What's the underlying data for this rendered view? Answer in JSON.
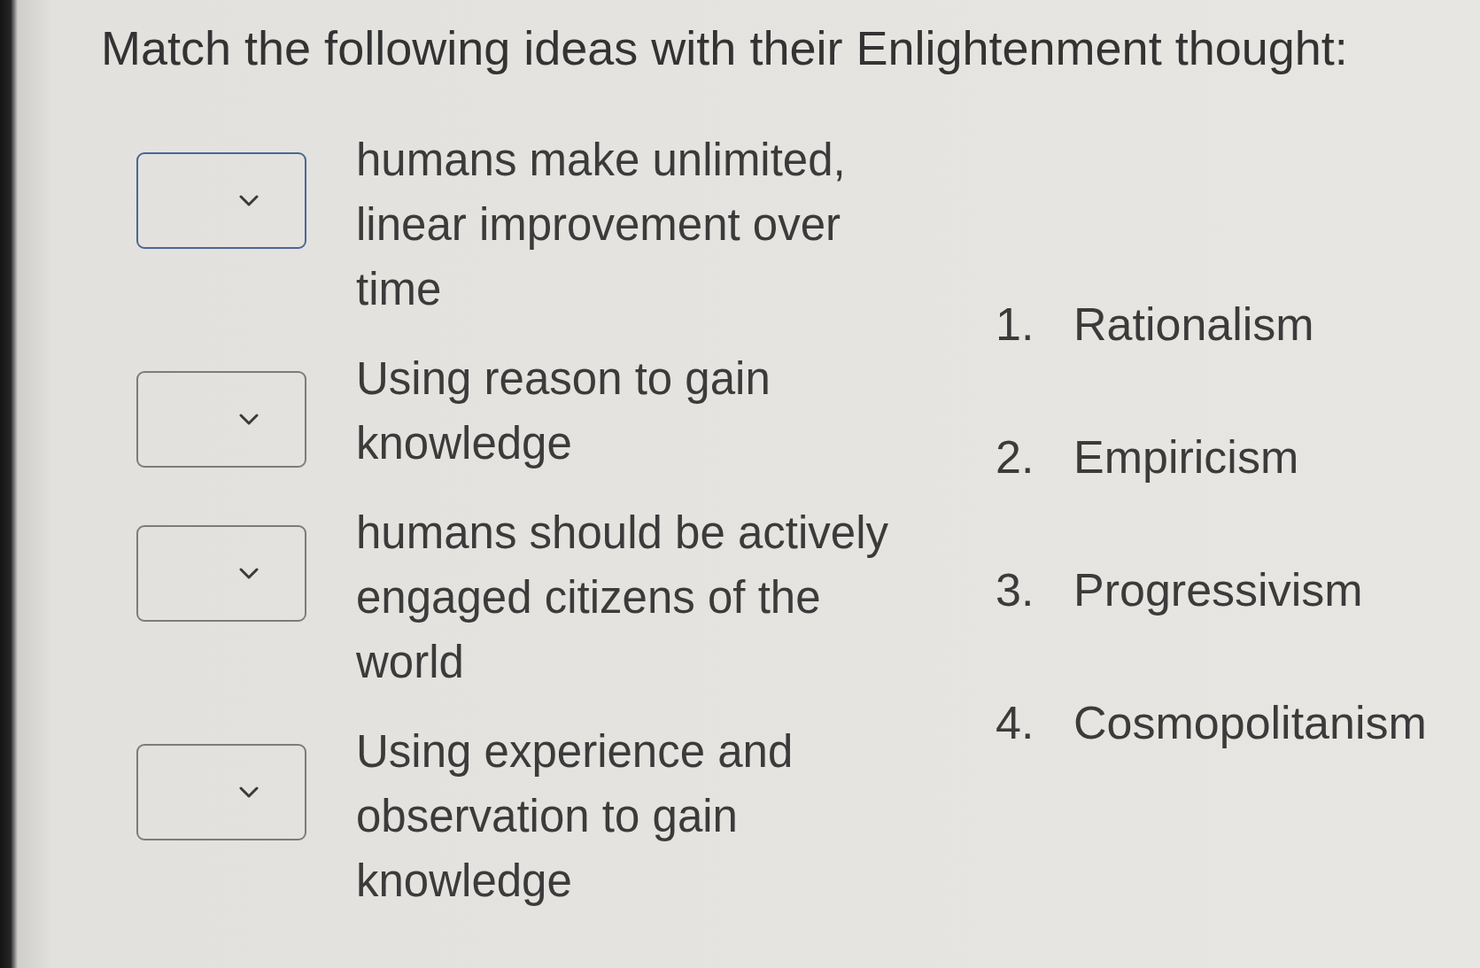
{
  "title": "Match the following ideas with their Enlightenment thought:",
  "items": [
    {
      "text": "humans make unlimited, linear improvement over time",
      "focused": true
    },
    {
      "text": "Using reason to gain knowledge",
      "focused": false
    },
    {
      "text": "humans should be actively engaged citizens of the world",
      "focused": false
    },
    {
      "text": "Using experience and observation to gain knowledge",
      "focused": false
    }
  ],
  "options": [
    {
      "number": "1.",
      "label": "Rationalism"
    },
    {
      "number": "2.",
      "label": "Empiricism"
    },
    {
      "number": "3.",
      "label": "Progressivism"
    },
    {
      "number": "4.",
      "label": "Cosmopolitanism"
    }
  ]
}
